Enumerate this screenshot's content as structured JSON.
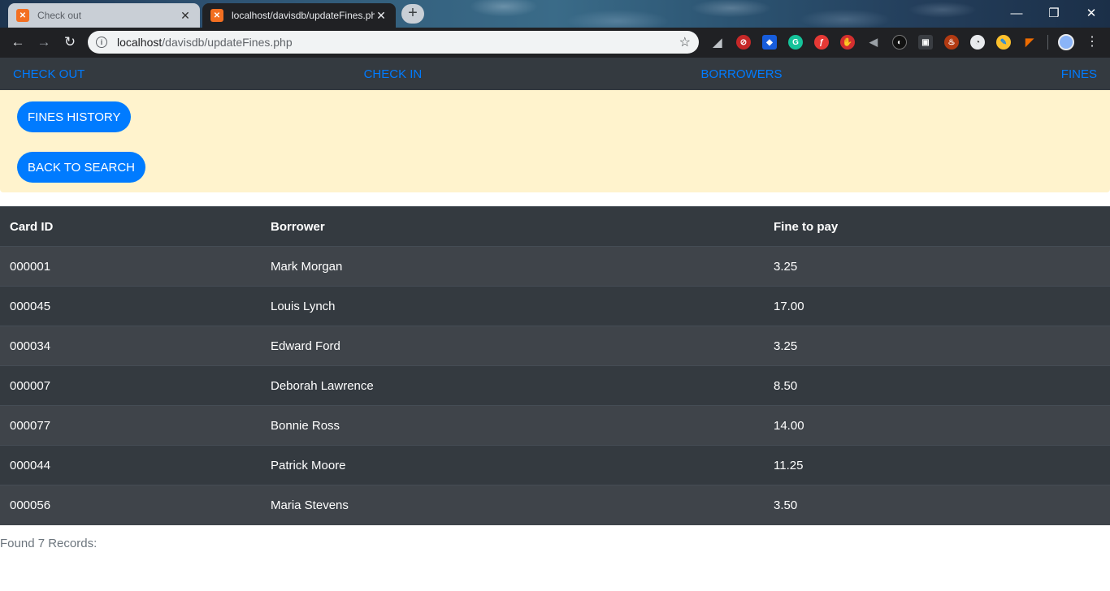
{
  "browser": {
    "tabs": [
      {
        "title": "Check out",
        "favicon": "xampp-icon",
        "active": false
      },
      {
        "title": "localhost/davisdb/updateFines.php",
        "favicon": "xampp-icon",
        "active": true
      }
    ],
    "new_tab_label": "+",
    "url_host": "localhost",
    "url_path": "/davisdb/updateFines.php",
    "window_controls": {
      "minimize": "—",
      "restore": "❐",
      "close": "✕"
    },
    "nav": {
      "back": "←",
      "forward": "→",
      "reload": "↻"
    },
    "star": "☆",
    "menu": "⋮"
  },
  "nav": {
    "check_out": "CHECK OUT",
    "check_in": "CHECK IN",
    "borrowers": "BORROWERS",
    "fines": "FINES"
  },
  "actions": {
    "fines_history": "FINES HISTORY",
    "back_to_search": "BACK TO SEARCH"
  },
  "table": {
    "headers": [
      "Card ID",
      "Borrower",
      "Fine to pay"
    ],
    "rows": [
      [
        "000001",
        "Mark Morgan",
        "3.25"
      ],
      [
        "000045",
        "Louis Lynch",
        "17.00"
      ],
      [
        "000034",
        "Edward Ford",
        "3.25"
      ],
      [
        "000007",
        "Deborah Lawrence",
        "8.50"
      ],
      [
        "000077",
        "Bonnie Ross",
        "14.00"
      ],
      [
        "000044",
        "Patrick Moore",
        "11.25"
      ],
      [
        "000056",
        "Maria Stevens",
        "3.50"
      ]
    ]
  },
  "footer": {
    "found_text": "Found 7 Records:"
  },
  "colors": {
    "link": "#007bff",
    "navbar": "#343a40",
    "alert_bg": "#fff3cd",
    "button": "#007bff",
    "table_dark": "#343a40",
    "table_stripe": "#3f444a"
  },
  "extensions": [
    "shark-icon",
    "block-icon",
    "bitwarden-icon",
    "grammarly-icon",
    "flash-icon",
    "stop-hand-icon",
    "audio-icon",
    "dark-mode-icon",
    "shield-icon",
    "fire-icon",
    "compass-icon",
    "color-picker-icon",
    "megaphone-icon"
  ]
}
